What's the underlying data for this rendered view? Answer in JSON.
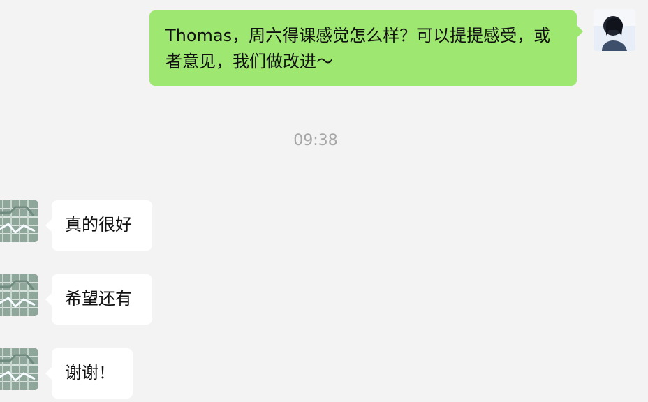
{
  "chat": {
    "messages": [
      {
        "sender": "self",
        "text": "Thomas，周六得课感觉怎么样？可以提提感受，或者意见，我们做改进～"
      },
      {
        "sender": "contact",
        "text": "真的很好"
      },
      {
        "sender": "contact",
        "text": "希望还有"
      },
      {
        "sender": "contact",
        "text": "谢谢！"
      }
    ],
    "timestamp": "09:38"
  },
  "colors": {
    "background": "#f3f3f3",
    "outgoing_bubble": "#9ee872",
    "incoming_bubble": "#ffffff",
    "timestamp": "#a7a7a7"
  },
  "icons": {
    "self_avatar": "user-avatar-icon",
    "contact_avatar": "contact-avatar-icon"
  }
}
